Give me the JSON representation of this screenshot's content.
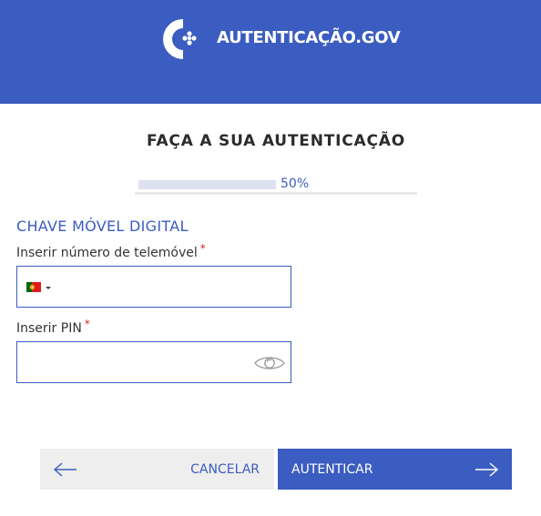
{
  "header": {
    "brand": "AUTENTICAÇÃO.GOV",
    "logo_icon": "autenticacao-gov-logo-icon",
    "background": "#3b5cc0"
  },
  "page": {
    "title": "FAÇA A SUA AUTENTICAÇÃO"
  },
  "progress": {
    "value": 0.5,
    "label": "50%"
  },
  "section": {
    "title": "CHAVE MÓVEL DIGITAL"
  },
  "phone_field": {
    "label": "Inserir número de telemóvel",
    "required_mark": "*",
    "value": "",
    "placeholder": "",
    "country_flag": "portugal-flag-icon"
  },
  "pin_field": {
    "label": "Inserir PIN",
    "required_mark": "*",
    "value": "",
    "placeholder": "",
    "toggle_icon": "eye-icon"
  },
  "actions": {
    "cancel_label": "CANCELAR",
    "cancel_icon": "arrow-left-icon",
    "submit_label": "AUTENTICAR",
    "submit_icon": "arrow-right-icon"
  },
  "colors": {
    "accent": "#3b5cc0",
    "required": "#d9262b",
    "secondary_button": "#eeeeee"
  }
}
